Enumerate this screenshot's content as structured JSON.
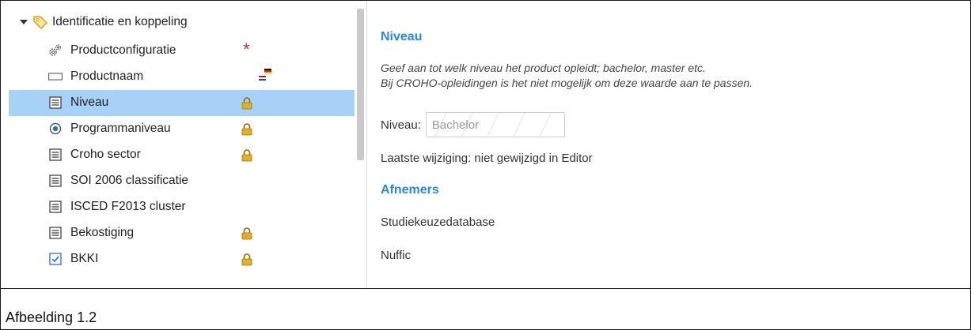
{
  "tree": {
    "root_label": "Identificatie en koppeling",
    "items": [
      {
        "label": "Productconfiguratie",
        "icon": "gears-icon",
        "mark": "required-asterisk"
      },
      {
        "label": "Productnaam",
        "icon": "textfield-icon",
        "mark": "flags-icon"
      },
      {
        "label": "Niveau",
        "icon": "list-icon",
        "mark": "lock-icon",
        "selected": true
      },
      {
        "label": "Programmaniveau",
        "icon": "radio-icon",
        "mark": "lock-icon"
      },
      {
        "label": "Croho sector",
        "icon": "list-icon",
        "mark": "lock-icon"
      },
      {
        "label": "SOI 2006 classificatie",
        "icon": "list-icon",
        "mark": ""
      },
      {
        "label": "ISCED F2013 cluster",
        "icon": "list-icon",
        "mark": ""
      },
      {
        "label": "Bekostiging",
        "icon": "list-icon",
        "mark": "lock-icon"
      },
      {
        "label": "BKKI",
        "icon": "checkbox-icon",
        "mark": "lock-icon"
      }
    ]
  },
  "detail": {
    "title": "Niveau",
    "help_line1": "Geef aan tot welk niveau het product opleidt; bachelor, master etc.",
    "help_line2": "Bij CROHO-opleidingen is het niet mogelijk om deze waarde aan te passen.",
    "field_label": "Niveau:",
    "field_value": "Bachelor",
    "last_change": "Laatste wijziging: niet gewijzigd in Editor",
    "afnemers_title": "Afnemers",
    "afnemers": [
      "Studiekeuzedatabase",
      "Nuffic"
    ]
  },
  "caption": "Afbeelding 1.2",
  "colors": {
    "accent": "#2a8ad8",
    "selected_row": "#a7d1f7",
    "lock": "#e2b021",
    "required": "#e8253a"
  }
}
